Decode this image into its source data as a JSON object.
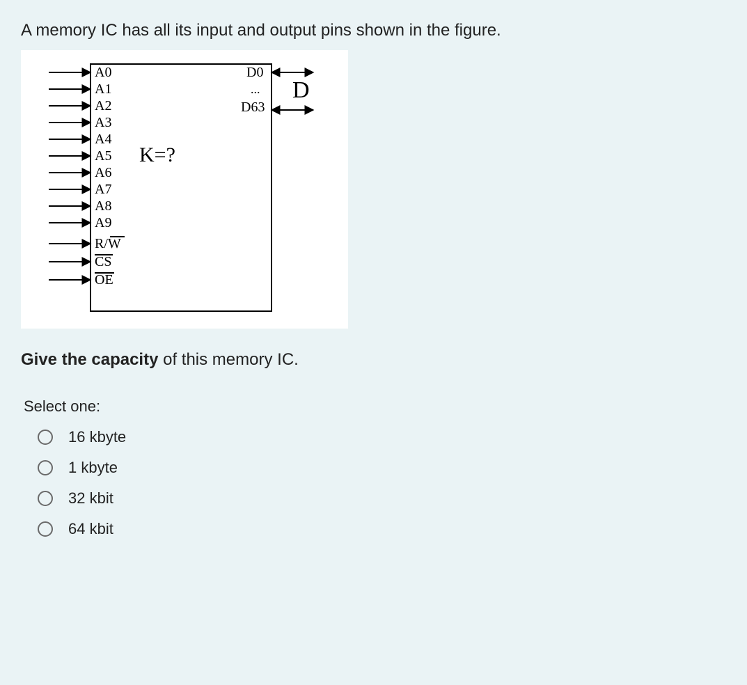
{
  "question": {
    "intro": "A memory IC has all its input and output pins shown in the figure.",
    "prompt_bold": "Give the capacity",
    "prompt_rest": " of this memory IC."
  },
  "diagram": {
    "left_pins": [
      "A0",
      "A1",
      "A2",
      "A3",
      "A4",
      "A5",
      "A6",
      "A7",
      "A8",
      "A9"
    ],
    "ctrl_pins": [
      {
        "text": "R/W",
        "overline_start": 2
      },
      {
        "text": "CS",
        "overline_start": 0
      },
      {
        "text": "OE",
        "overline_start": 0
      }
    ],
    "right_top": "D0",
    "right_dots": "...",
    "right_bottom": "D63",
    "k_label": "K=?",
    "d_label": "D"
  },
  "select": {
    "header": "Select one:",
    "options": [
      "16 kbyte",
      "1 kbyte",
      "32 kbit",
      "64 kbit"
    ]
  }
}
